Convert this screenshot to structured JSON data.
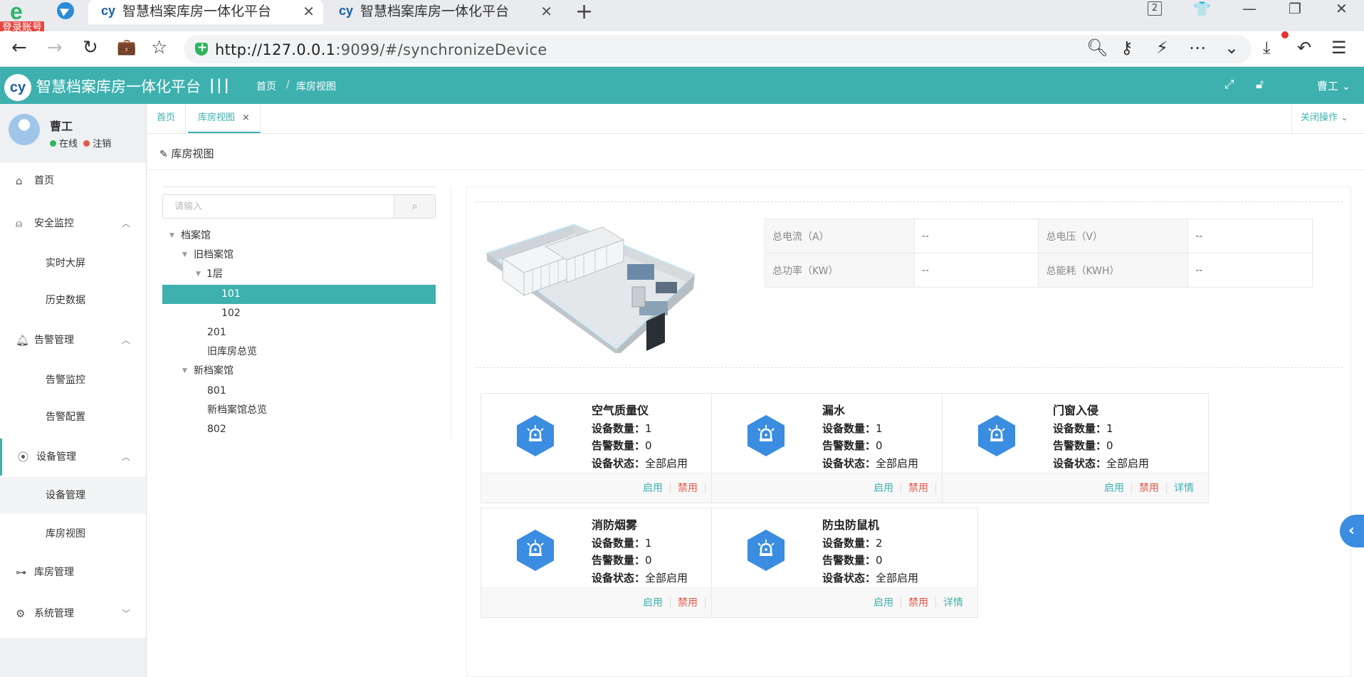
{
  "browser": {
    "login_badge": "登录账号",
    "tabs": [
      {
        "label": "智慧档案库房一体化平台"
      },
      {
        "label": "智慧档案库房一体化平台"
      }
    ],
    "url_host": "http://127.0.0.1",
    "url_rest": ":9099/#/synchronizeDevice",
    "tab_count": "2"
  },
  "header": {
    "title": "智慧档案库房一体化平台",
    "breadcrumb_home": "首页",
    "breadcrumb_sep": "/",
    "breadcrumb_current": "库房视图",
    "user": "曹工"
  },
  "profile": {
    "name": "曹工",
    "online": "在线",
    "logout": "注销",
    "online_color": "#2db55d",
    "logout_color": "#e2584a"
  },
  "sidebar": {
    "home": "首页",
    "security": "安全监控",
    "security_items": [
      "实时大屏",
      "历史数据"
    ],
    "alarm": "告警管理",
    "alarm_items": [
      "告警监控",
      "告警配置"
    ],
    "device": "设备管理",
    "device_items": [
      "设备管理",
      "库房视图"
    ],
    "warehouse": "库房管理",
    "system": "系统管理"
  },
  "page_tabs": {
    "home": "首页",
    "current": "库房视图",
    "close_ops": "关闭操作"
  },
  "page_title": "库房视图",
  "search": {
    "placeholder": "请输入"
  },
  "tree": [
    {
      "label": "档案馆"
    },
    {
      "label": "旧档案馆"
    },
    {
      "label": "1层"
    },
    {
      "label": "101"
    },
    {
      "label": "102"
    },
    {
      "label": "201"
    },
    {
      "label": "旧库房总览"
    },
    {
      "label": "新档案馆"
    },
    {
      "label": "801"
    },
    {
      "label": "新档案馆总览"
    },
    {
      "label": "802"
    }
  ],
  "metrics": {
    "current_label": "总电流（A）",
    "current_value": "--",
    "voltage_label": "总电压（V）",
    "voltage_value": "--",
    "power_label": "总功率（KW）",
    "power_value": "--",
    "energy_label": "总能耗（KWH）",
    "energy_value": "--"
  },
  "card_fields": {
    "count": "设备数量：",
    "alarm": "告警数量：",
    "status": "设备状态："
  },
  "card_actions": {
    "enable": "启用",
    "disable": "禁用",
    "detail": "详情"
  },
  "cards": [
    {
      "title": "空气质量仪",
      "count": "1",
      "alarm": "0",
      "status": "全部启用"
    },
    {
      "title": "漏水",
      "count": "1",
      "alarm": "0",
      "status": "全部启用"
    },
    {
      "title": "门窗入侵",
      "count": "1",
      "alarm": "0",
      "status": "全部启用"
    },
    {
      "title": "消防烟雾",
      "count": "1",
      "alarm": "0",
      "status": "全部启用"
    },
    {
      "title": "防虫防鼠机",
      "count": "2",
      "alarm": "0",
      "status": "全部启用"
    }
  ],
  "colors": {
    "accent": "#3eb1af",
    "device_icon": "#3a8de0",
    "danger": "#e2584a"
  }
}
